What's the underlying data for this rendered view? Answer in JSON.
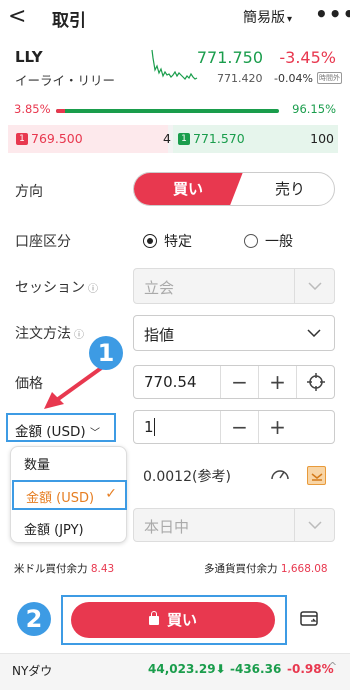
{
  "header": {
    "back": "<",
    "title": "取引",
    "mode": "簡易版",
    "mode_caret": "▾",
    "more": "•••"
  },
  "stock": {
    "ticker": "LLY",
    "name": "イーライ・リリー",
    "price": "771.750",
    "change_pct": "-3.45%",
    "prev": "771.420",
    "prev_pct": "-0.04%",
    "badge": "時間外"
  },
  "ratio": {
    "left": "3.85%",
    "right": "96.15%",
    "left_fraction": 0.0385
  },
  "book": {
    "bid_level": "1",
    "bid_price": "769.500",
    "bid_qty": "4",
    "ask_level": "1",
    "ask_price": "771.570",
    "ask_qty": "100"
  },
  "form": {
    "direction_label": "方向",
    "buy": "買い",
    "sell": "売り",
    "account_label": "口座区分",
    "account_opt1": "特定",
    "account_opt2": "一般",
    "session_label": "セッション",
    "session_value": "立会",
    "order_method_label": "注文方法",
    "order_method_value": "指値",
    "price_label": "価格",
    "price_value": "770.54",
    "amount_select": "金額 (USD)",
    "amount_value": "1",
    "reference": "0.0012(参考)",
    "period_value": "本日中",
    "minus": "−",
    "plus": "+"
  },
  "menu": {
    "items": [
      "数量",
      "金額 (USD)",
      "金額 (JPY)"
    ],
    "selected": 1
  },
  "avail": {
    "usd_label": "米ドル買付余力",
    "usd_value": "8.43",
    "multi_label": "多通貨買付余力",
    "multi_value": "1,668.08"
  },
  "order_button": "買い",
  "annotations": {
    "step1": "1",
    "step2": "2"
  },
  "index": {
    "name": "NYダウ",
    "value": "44,023.29",
    "arrow": "⬇",
    "change": "-436.36",
    "pct": "-0.98%",
    "expand": "^"
  },
  "colors": {
    "red": "#e8384f",
    "green": "#1a9d4c",
    "blue": "#3d9be4",
    "orange": "#e67e22"
  }
}
